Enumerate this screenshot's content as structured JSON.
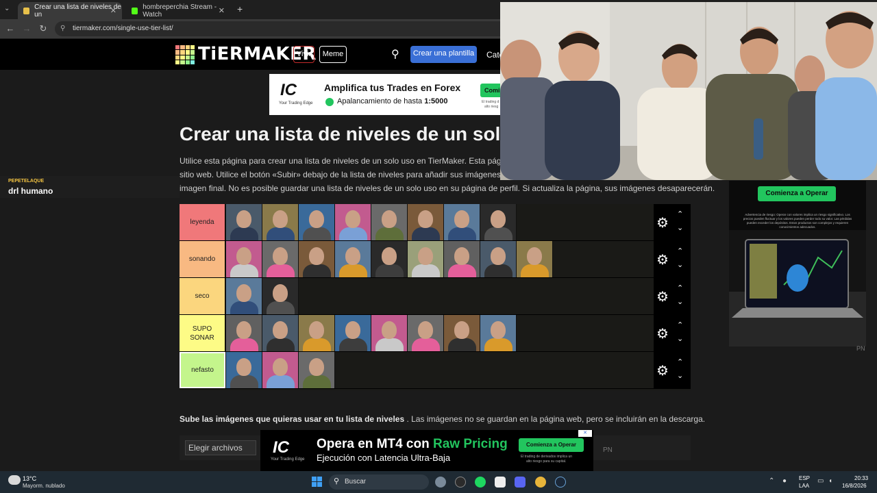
{
  "browser": {
    "tabs": [
      {
        "label": "Crear una lista de niveles de un",
        "active": true
      },
      {
        "label": "hombreperchia Stream - Watch",
        "active": false
      }
    ],
    "new_tab_glyph": "+",
    "url": "tiermaker.com/single-use-tier-list/"
  },
  "site": {
    "logo_text": "TiERMAKER",
    "nav": {
      "live": "Vivir",
      "meme": "Meme",
      "create": "Crear una plantilla",
      "categories": "Cate"
    }
  },
  "ad_top": {
    "brand": "IC",
    "tagline": "Your Trading Edge",
    "headline": "Amplifica tus Trades en Forex",
    "subline": "Apalancamiento de hasta",
    "leverage": "1:5000",
    "cta": "Comi",
    "fine1": "El trading d",
    "fine2": "alto riesg"
  },
  "page": {
    "title": "Crear una lista de niveles de un solo",
    "intro_line1": "Utilice esta página para crear una lista de niveles de un solo uso en TierMaker. Esta página n",
    "intro_line2": "sitio web. Utilice el botón «Subir» debajo de la lista de niveles para añadir sus imágenes. Una",
    "intro_line3": "imagen final. No es posible guardar una lista de niveles de un solo uso en su página de perfil. Si actualiza la página, sus imágenes desaparecerán.",
    "upload_bold": "Sube las imágenes que quieras usar en tu lista de niveles",
    "upload_rest": ". Las imágenes no se guardan en la página web, pero se incluirán en la descarga.",
    "choose_files": "Elegir archivos"
  },
  "overlay": {
    "name_small": "PEPETELAQUE",
    "name_big": "drl humano"
  },
  "tiers": [
    {
      "label": "leyenda",
      "color": "#f0787a",
      "count": 8
    },
    {
      "label": "sonando",
      "color": "#f8b982",
      "count": 9
    },
    {
      "label": "seco",
      "color": "#fbd67e",
      "count": 2
    },
    {
      "label": "SUPO SONAR",
      "color": "#fdfb86",
      "count": 8
    },
    {
      "label": "nefasto",
      "color": "#c4f58c",
      "count": 3
    }
  ],
  "tier_controls": {
    "gear": "⚙",
    "up": "⌃",
    "down": "⌄"
  },
  "ad_right": {
    "cta": "Comienza a Operar",
    "disclaimer": "Advertencia de riesgo: Operar con valores implica un riesgo significativo. Los precios pueden fluctuar y los valores pueden perder todo su valor. Las pérdidas pueden exceder los depósitos. Estos productos son complejos y requieren conocimientos adecuados.",
    "watermark": "PN"
  },
  "ad_bottom": {
    "brand": "IC",
    "tagline": "Your Trading Edge",
    "headline_a": "Opera en MT4 con ",
    "headline_b": "Raw Pricing",
    "subline": "Ejecución con Latencia Ultra-Baja",
    "cta": "Comienza a Operar",
    "fine1": "El trading de derivados implica un",
    "fine2": "alto riesgo para su capital.",
    "watermark": "PN"
  },
  "taskbar": {
    "temp": "13°C",
    "weather": "Mayorm. nublado",
    "search": "Buscar",
    "lang1": "ESP",
    "lang2": "LAA",
    "time": "20:33",
    "date": "16/8/2026"
  },
  "colors": {
    "accent_blue": "#3a6fd6",
    "green_cta": "#22c55e"
  }
}
